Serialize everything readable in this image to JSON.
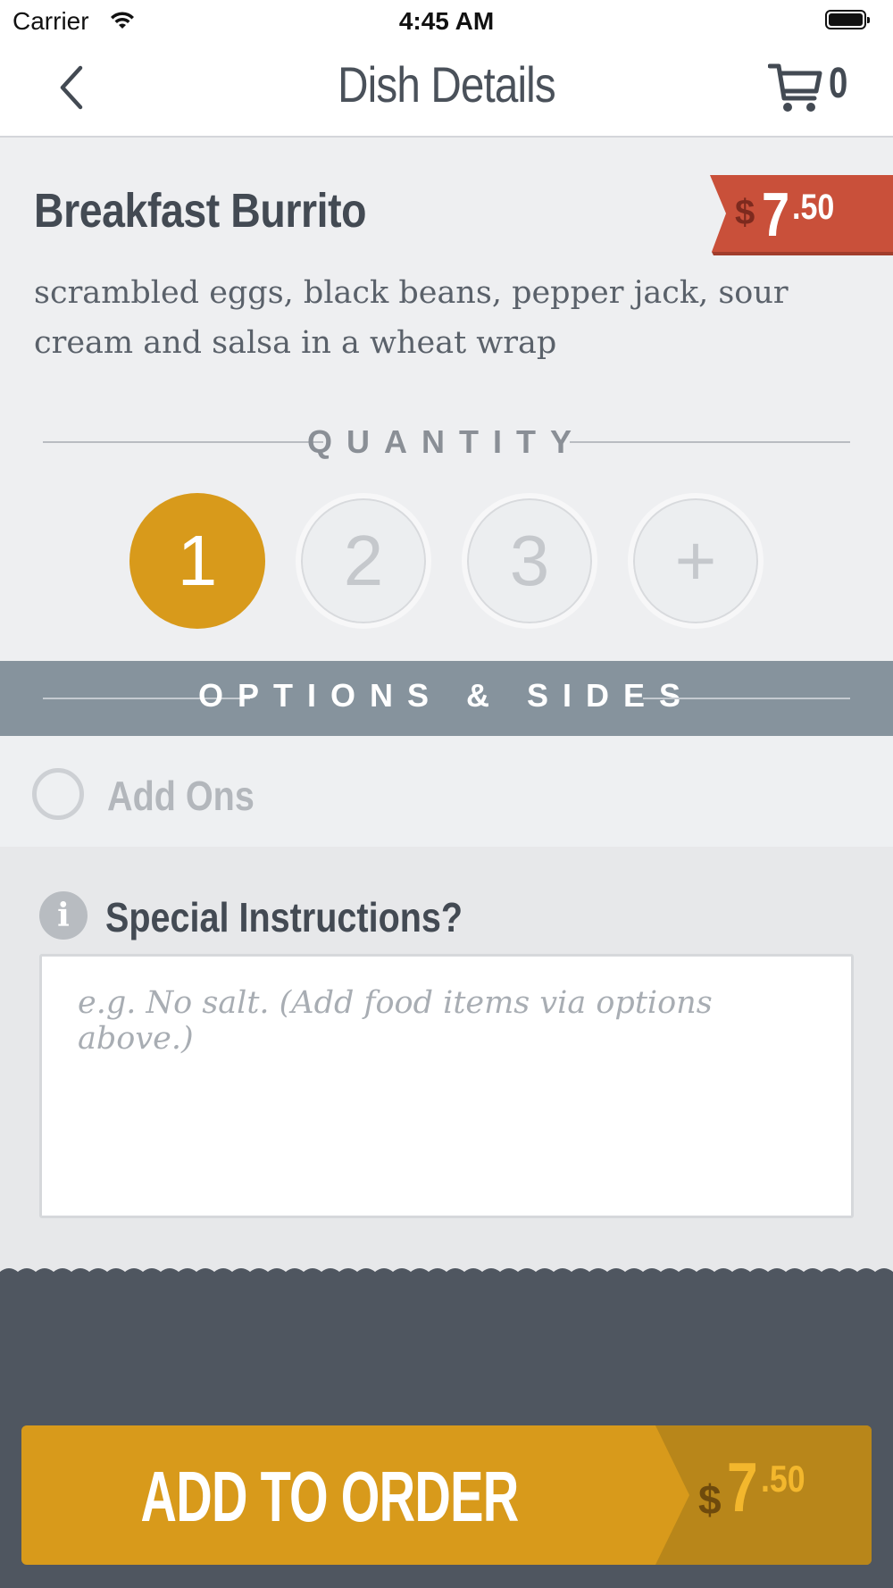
{
  "status_bar": {
    "carrier": "Carrier",
    "time": "4:45 AM"
  },
  "nav": {
    "title": "Dish Details",
    "cart_count": "0"
  },
  "dish": {
    "name": "Breakfast Burrito",
    "description": "scrambled eggs, black beans, pepper jack, sour cream and salsa in a wheat wrap",
    "price": {
      "currency": "$",
      "dollars": "7",
      "cents": ".50"
    }
  },
  "quantity": {
    "label": "QUANTITY",
    "options": [
      "1",
      "2",
      "3",
      "+"
    ],
    "selected": "1"
  },
  "options": {
    "label": "OPTIONS & SIDES",
    "addons_label": "Add Ons"
  },
  "special": {
    "label": "Special Instructions?",
    "placeholder": "e.g. No salt. (Add food items via options above.)",
    "value": ""
  },
  "add_button": {
    "label": "ADD TO ORDER",
    "currency": "$",
    "dollars": "7",
    "cents": ".50"
  },
  "colors": {
    "accent": "#d89a1b",
    "price_tag": "#c9503a",
    "options_band": "#86939d",
    "footer": "#4f5660"
  }
}
